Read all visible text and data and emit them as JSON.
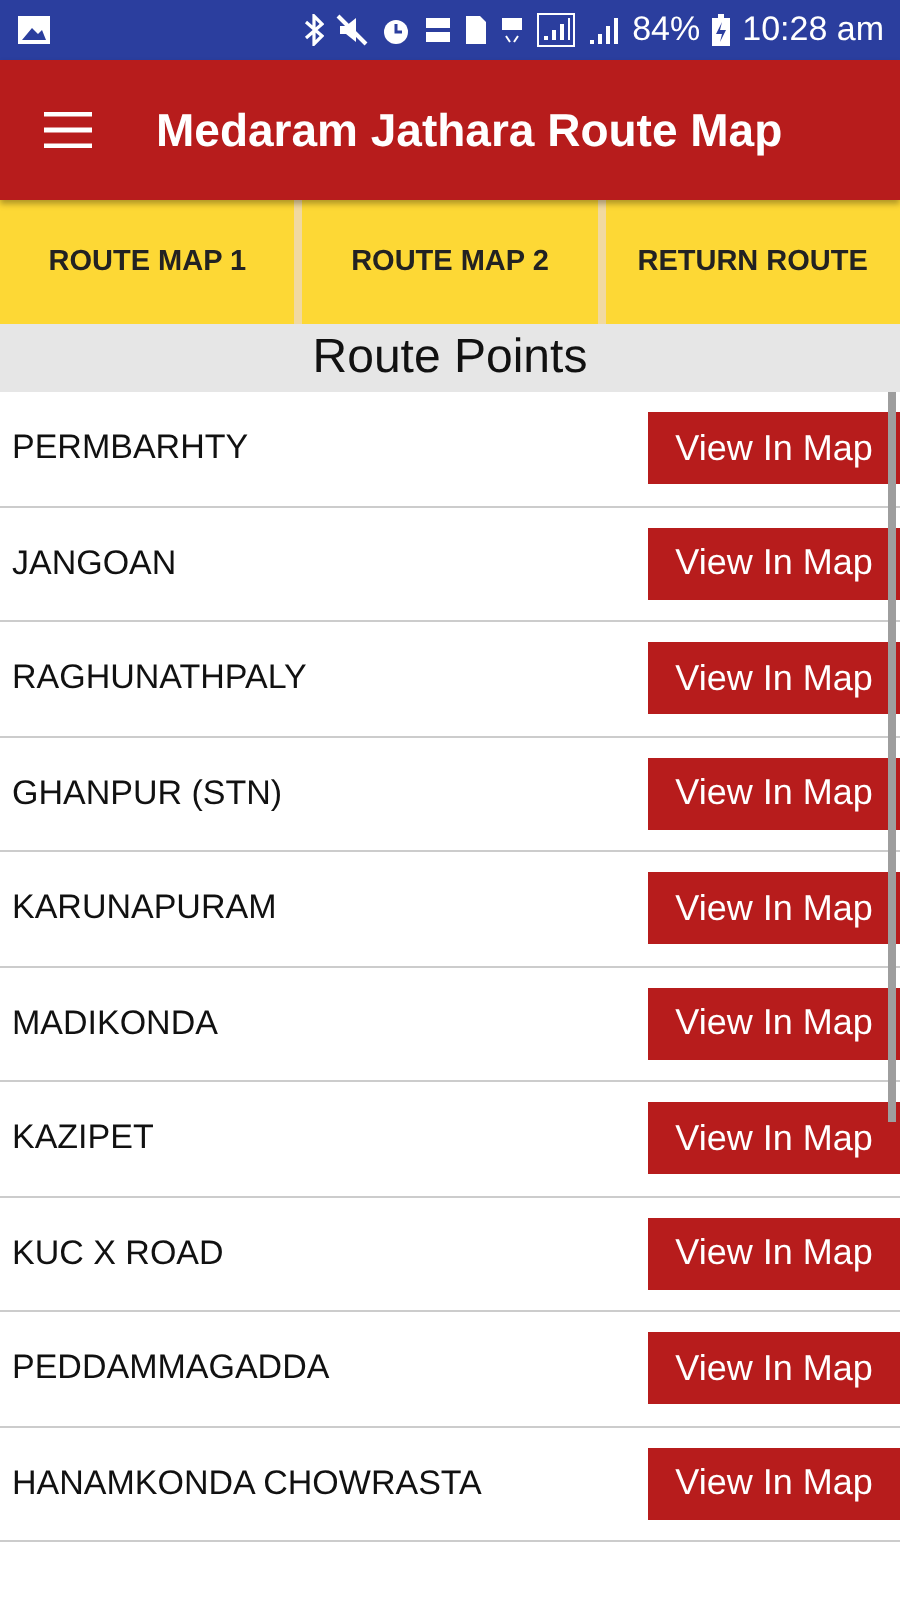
{
  "status_bar": {
    "battery": "84%",
    "time": "10:28 am"
  },
  "app_bar": {
    "title": "Medaram Jathara Route Map"
  },
  "tabs": [
    {
      "label": "ROUTE MAP 1"
    },
    {
      "label": "ROUTE MAP 2"
    },
    {
      "label": "RETURN ROUTE"
    }
  ],
  "section_title": "Route Points",
  "route_points": [
    {
      "name": "PERMBARHTY",
      "button": "View In Map"
    },
    {
      "name": "JANGOAN",
      "button": "View In Map"
    },
    {
      "name": "RAGHUNATHPALY",
      "button": "View In Map"
    },
    {
      "name": "GHANPUR (STN)",
      "button": "View In Map"
    },
    {
      "name": "KARUNAPURAM",
      "button": "View In Map"
    },
    {
      "name": "MADIKONDA",
      "button": "View In Map"
    },
    {
      "name": "KAZIPET",
      "button": "View In Map"
    },
    {
      "name": "KUC X ROAD",
      "button": "View In Map"
    },
    {
      "name": "PEDDAMMAGADDA",
      "button": "View In Map"
    },
    {
      "name": "HANAMKONDA CHOWRASTA",
      "button": "View In Map"
    }
  ]
}
